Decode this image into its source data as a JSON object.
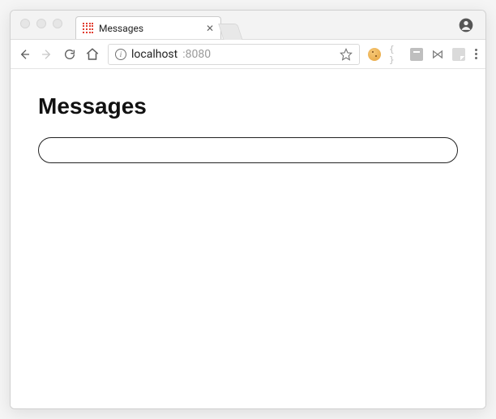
{
  "window": {
    "tab_title": "Messages",
    "favicon": "grid-red-icon",
    "profile_icon": "profile-icon"
  },
  "toolbar": {
    "back_icon": "arrow-left-icon",
    "forward_icon": "arrow-right-icon",
    "reload_icon": "reload-icon",
    "home_icon": "home-icon",
    "security_icon": "info-icon",
    "url_host": "localhost",
    "url_port": ":8080",
    "star_icon": "star-icon",
    "extensions": [
      {
        "name": "cookie-ext-icon"
      },
      {
        "name": "braces-ext-icon",
        "label": "{ }"
      },
      {
        "name": "square-ext-icon"
      },
      {
        "name": "bowtie-ext-icon"
      },
      {
        "name": "note-ext-icon"
      }
    ],
    "menu_icon": "kebab-menu-icon"
  },
  "page": {
    "heading": "Messages",
    "input_value": "",
    "input_placeholder": ""
  }
}
